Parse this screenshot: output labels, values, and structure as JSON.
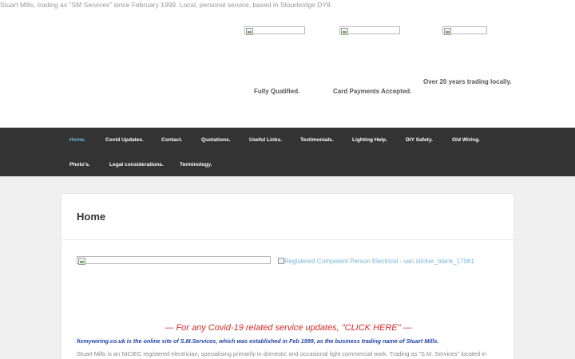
{
  "header": {
    "tagline": "Stuart Mills, trading as \"SM Services\" since February 1999. Local, personal service, based in Stourbridge DY8.",
    "features": [
      {
        "label": "Fully Qualified."
      },
      {
        "label": "Card Payments Accepted."
      },
      {
        "label": "Over 20 years trading locally."
      }
    ]
  },
  "nav": {
    "items": [
      {
        "label": "Home.",
        "active": true
      },
      {
        "label": "Covid Updates."
      },
      {
        "label": "Contact."
      },
      {
        "label": "Quotations."
      },
      {
        "label": "Useful Links."
      },
      {
        "label": "Testimonials."
      },
      {
        "label": "Lighting Help."
      },
      {
        "label": "DIY Safety."
      },
      {
        "label": "Old Wiring."
      },
      {
        "label": "Photo's."
      },
      {
        "label": "Legal considerations."
      },
      {
        "label": "Terminology."
      }
    ]
  },
  "main": {
    "title": "Home",
    "nic_link": "Registered Competent Person Electrical - van sticker_blank_17061",
    "covid_link": "— For any Covid-19 related service updates, \"CLICK HERE\" —",
    "intro": "fixmywiring.co.uk is the online site of S.M.Services, which was established in Feb 1999, as the business trading name of Stuart Mills.",
    "body": "Stuart Mills is an NICIEC registered electrician, specialising primarily in domestic and occasional light commercial work. Trading as \"S.M. Services\" located in"
  },
  "colors": {
    "nav_bg": "#333333",
    "nav_active": "#6cb6de",
    "covid_red": "#d62b2b",
    "intro_blue": "#2244a8",
    "link_blue": "#76b7d4"
  }
}
